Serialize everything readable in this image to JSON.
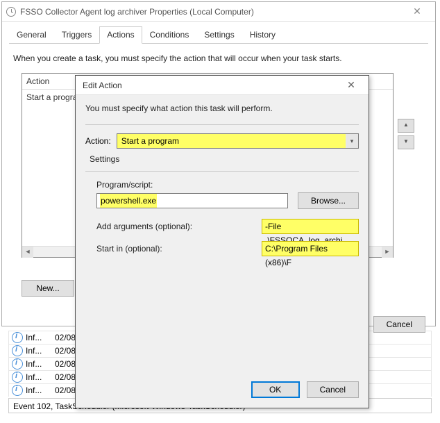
{
  "main": {
    "title": "FSSO Collector Agent log archiver Properties (Local Computer)",
    "tabs": [
      "General",
      "Triggers",
      "Actions",
      "Conditions",
      "Settings",
      "History"
    ],
    "active_tab": 2,
    "instruction": "When you create a task, you must specify the action that will occur when your task starts.",
    "list": {
      "header": "Action",
      "row0": "Start a progra"
    },
    "new_btn": "New...",
    "cancel_btn": "Cancel"
  },
  "dlg": {
    "title": "Edit Action",
    "msg": "You must specify what action this task will perform.",
    "action_label": "Action:",
    "action_value": "Start a program",
    "settings_label": "Settings",
    "program_label": "Program/script:",
    "program_value": "powershell.exe",
    "browse_btn": "Browse...",
    "args_label": "Add arguments (optional):",
    "args_value": "-File .\\FSSOCA_log_archi",
    "startin_label": "Start in (optional):",
    "startin_value": "C:\\Program Files (x86)\\F",
    "ok_btn": "OK",
    "cancel_btn": "Cancel"
  },
  "events": {
    "rows": [
      {
        "level": "Inf...",
        "date": "02/08..."
      },
      {
        "level": "Inf...",
        "date": "02/08..."
      },
      {
        "level": "Inf...",
        "date": "02/08..."
      },
      {
        "level": "Inf...",
        "date": "02/08..."
      },
      {
        "level": "Inf...",
        "date": "02/08..."
      }
    ],
    "detail": "Event 102, TaskScheduler (Microsoft-Windows-TaskScheduler)"
  }
}
